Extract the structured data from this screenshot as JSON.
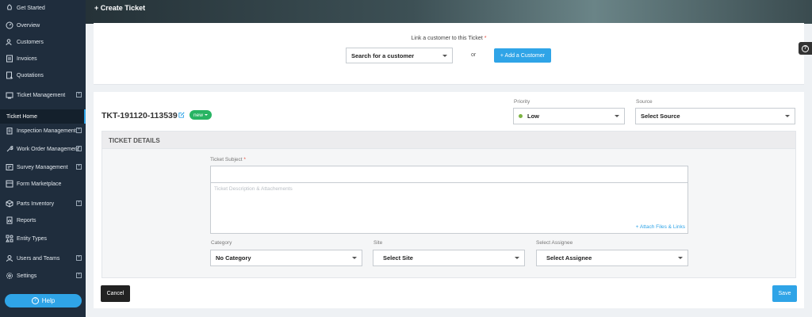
{
  "header": {
    "title": "+ Create Ticket"
  },
  "sidebar": {
    "items": [
      {
        "label": "Get Started",
        "icon": "rocket-icon",
        "expandable": false
      },
      {
        "label": "Overview",
        "icon": "dashboard-icon",
        "expandable": false
      },
      {
        "label": "Customers",
        "icon": "users-icon",
        "expandable": false
      },
      {
        "label": "Invoices",
        "icon": "invoice-icon",
        "expandable": false
      },
      {
        "label": "Quotations",
        "icon": "quote-icon",
        "expandable": false
      },
      {
        "label": "Ticket Management",
        "icon": "ticket-icon",
        "expandable": true
      },
      {
        "label": "Inspection Management",
        "icon": "clipboard-icon",
        "expandable": true
      },
      {
        "label": "Work Order Management",
        "icon": "wrench-icon",
        "expandable": true
      },
      {
        "label": "Survey Management",
        "icon": "survey-icon",
        "expandable": true
      },
      {
        "label": "Form Marketplace",
        "icon": "form-icon",
        "expandable": false
      },
      {
        "label": "Parts Inventory",
        "icon": "box-icon",
        "expandable": true
      },
      {
        "label": "Reports",
        "icon": "report-icon",
        "expandable": false
      },
      {
        "label": "Entity Types",
        "icon": "shapes-icon",
        "expandable": false
      },
      {
        "label": "Users and Teams",
        "icon": "user-icon",
        "expandable": true
      },
      {
        "label": "Settings",
        "icon": "gear-icon",
        "expandable": true
      }
    ],
    "sub_item": "Ticket Home",
    "help_label": "Help"
  },
  "customer": {
    "link_label": "Link a customer to this Ticket",
    "required_mark": "*",
    "search_value": "Search for a customer",
    "or_text": "or",
    "add_button": "+ Add a Customer"
  },
  "ticket": {
    "id": "TKT-191120-113539",
    "status": "new",
    "status_color": "#28b463",
    "priority_label": "Priority",
    "priority_value": "Low",
    "priority_color": "#7cb342",
    "source_label": "Source",
    "source_value": "Select Source"
  },
  "details": {
    "title": "TICKET DETAILS",
    "subject_label": "Ticket Subject",
    "required_mark": "*",
    "subject_value": "",
    "description_placeholder": "Ticket Description & Attachements",
    "attach_link": "+ Attach Files & Links",
    "category_label": "Category",
    "category_value": "No Category",
    "site_label": "Site",
    "site_value": "Select Site",
    "assignee_label": "Select Assignee",
    "assignee_value": "Select Assignee"
  },
  "actions": {
    "cancel": "Cancel",
    "save": "Save"
  },
  "colors": {
    "accent": "#2fa4e7",
    "sidebar_bg": "#1f2d3d"
  }
}
